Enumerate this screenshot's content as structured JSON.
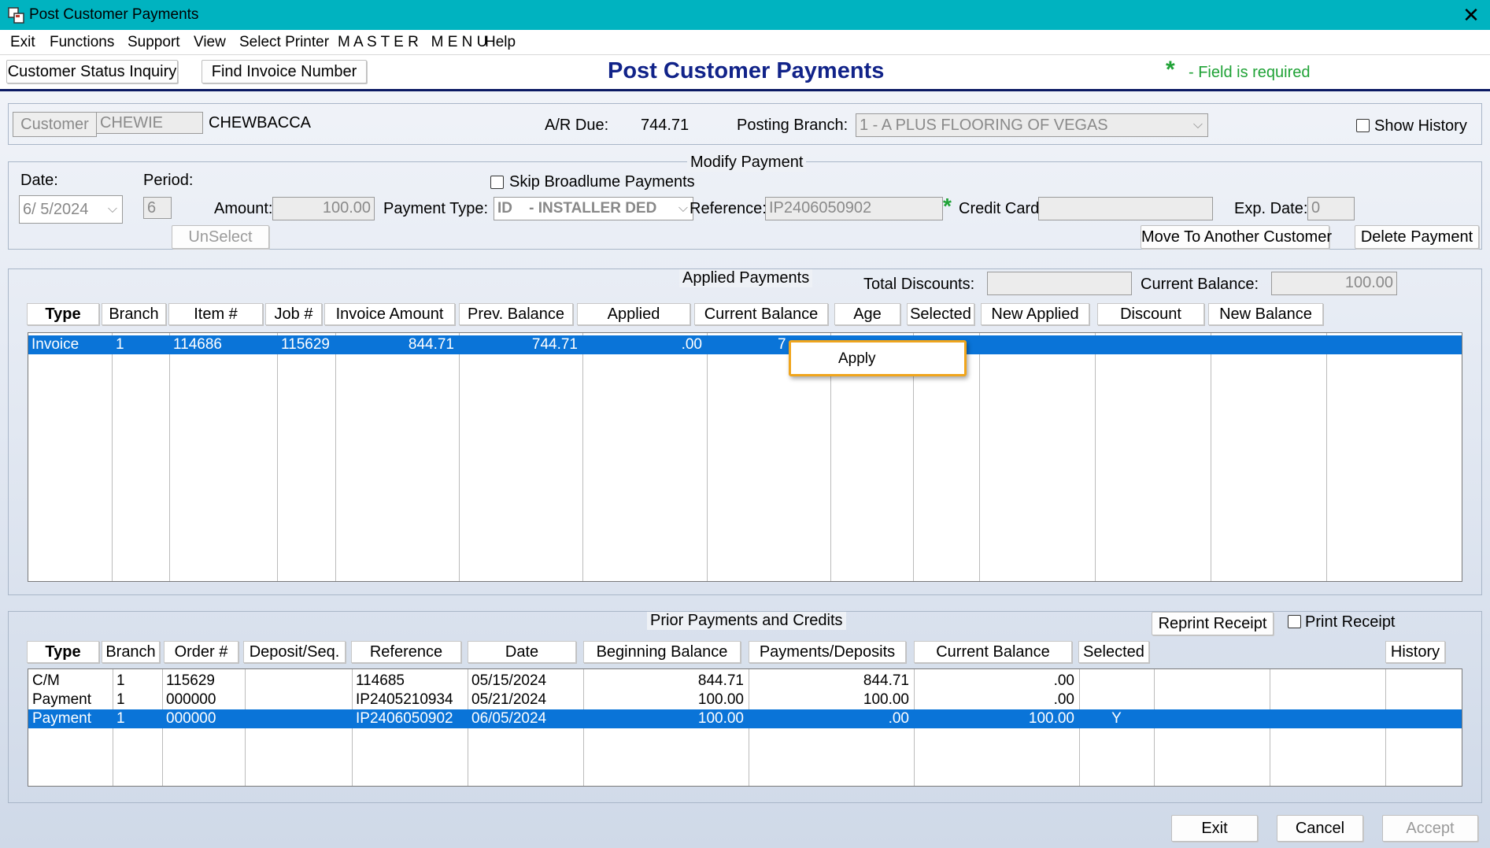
{
  "window": {
    "title": "Post Customer Payments",
    "close_glyph": "✕"
  },
  "menu": [
    "Exit",
    "Functions",
    "Support",
    "View",
    "Select Printer",
    "M A S T E R   M E N U",
    "Help"
  ],
  "toolbar": {
    "status_inquiry": "Customer Status Inquiry",
    "find_invoice": "Find Invoice Number",
    "page_title": "Post Customer Payments",
    "required_star": "*",
    "required_note": "- Field is required"
  },
  "customer": {
    "label": "Customer",
    "code": "CHEWIE",
    "name": "CHEWBACCA",
    "ar_due_label": "A/R Due:",
    "ar_due": "744.71",
    "posting_branch_label": "Posting Branch:",
    "posting_branch": "1  - A PLUS FLOORING OF VEGAS",
    "show_history": "Show History"
  },
  "payment": {
    "group_label": "Modify Payment",
    "date_label": "Date:",
    "date": "6/  5/2024",
    "period_label": "Period:",
    "period": "6",
    "amount_label": "Amount:",
    "amount": "100.00",
    "skip_broadlume": "Skip Broadlume Payments",
    "payment_type_label": "Payment Type:",
    "payment_type": "ID    - INSTALLER DED",
    "reference_label": "Reference:",
    "reference": "IP2406050902",
    "credit_card_label": "Credit Card:",
    "credit_card": "",
    "exp_date_label": "Exp. Date:",
    "exp_date": "0",
    "unselect": "UnSelect",
    "move_customer": "Move To Another Customer",
    "delete_payment": "Delete Payment"
  },
  "applied": {
    "group_label": "Applied Payments",
    "total_discounts_label": "Total Discounts:",
    "total_discounts": "",
    "current_balance_label": "Current Balance:",
    "current_balance": "100.00",
    "columns": [
      "Type",
      "Branch",
      "Item #",
      "Job #",
      "Invoice Amount",
      "Prev. Balance",
      "Applied",
      "Current Balance",
      "Age",
      "Selected",
      "New Applied",
      "Discount",
      "New Balance"
    ],
    "rows": [
      {
        "type": "Invoice",
        "branch": "1",
        "item": "114686",
        "job": "115629",
        "invoice_amount": "844.71",
        "prev_balance": "744.71",
        "applied": ".00",
        "current_balance": "7"
      }
    ],
    "context_menu": {
      "apply": "Apply"
    }
  },
  "prior": {
    "group_label": "Prior Payments and Credits",
    "reprint_receipt": "Reprint Receipt",
    "print_receipt": "Print Receipt",
    "history": "History",
    "columns": [
      "Type",
      "Branch",
      "Order #",
      "Deposit/Seq.",
      "Reference",
      "Date",
      "Beginning Balance",
      "Payments/Deposits",
      "Current Balance",
      "Selected"
    ],
    "rows": [
      {
        "type": "C/M",
        "branch": "1",
        "order": "115629",
        "deposit": "",
        "reference": "114685",
        "date": "05/15/2024",
        "beginning": "844.71",
        "payments": "844.71",
        "current": ".00",
        "selected": ""
      },
      {
        "type": "Payment",
        "branch": "1",
        "order": "000000",
        "deposit": "",
        "reference": "IP2405210934",
        "date": "05/21/2024",
        "beginning": "100.00",
        "payments": "100.00",
        "current": ".00",
        "selected": ""
      },
      {
        "type": "Payment",
        "branch": "1",
        "order": "000000",
        "deposit": "",
        "reference": "IP2406050902",
        "date": "06/05/2024",
        "beginning": "100.00",
        "payments": ".00",
        "current": "100.00",
        "selected": "Y"
      }
    ],
    "selected_row": 2
  },
  "footer": {
    "exit": "Exit",
    "cancel": "Cancel",
    "accept": "Accept"
  },
  "colors": {
    "titlebar": "#00b3c0",
    "selection": "#0a74d8",
    "title_text": "#112389",
    "required": "#1fa236",
    "popup_border": "#f0a51c"
  }
}
